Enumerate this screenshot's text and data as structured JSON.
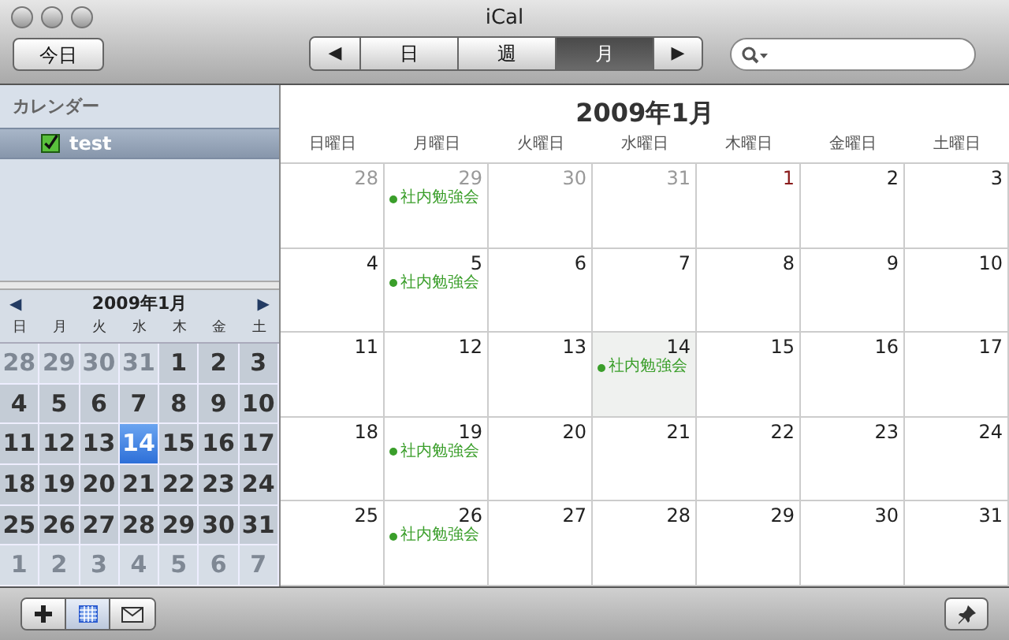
{
  "window": {
    "title": "iCal"
  },
  "toolbar": {
    "today_button": "今日",
    "prev": "◀",
    "next": "▶",
    "views": [
      {
        "label": "日",
        "selected": false
      },
      {
        "label": "週",
        "selected": false
      },
      {
        "label": "月",
        "selected": true
      }
    ]
  },
  "sidebar": {
    "header": "カレンダー",
    "calendars": [
      {
        "name": "test",
        "checked": true,
        "selected": true
      }
    ]
  },
  "mini_calendar": {
    "title": "2009年1月",
    "prev": "◀",
    "next": "▶",
    "weekdays": [
      "日",
      "月",
      "火",
      "水",
      "木",
      "金",
      "土"
    ],
    "days": [
      {
        "label": "28",
        "in_month": false,
        "selected": false
      },
      {
        "label": "29",
        "in_month": false,
        "selected": false
      },
      {
        "label": "30",
        "in_month": false,
        "selected": false
      },
      {
        "label": "31",
        "in_month": false,
        "selected": false
      },
      {
        "label": "1",
        "in_month": true,
        "selected": false
      },
      {
        "label": "2",
        "in_month": true,
        "selected": false
      },
      {
        "label": "3",
        "in_month": true,
        "selected": false
      },
      {
        "label": "4",
        "in_month": true,
        "selected": false
      },
      {
        "label": "5",
        "in_month": true,
        "selected": false
      },
      {
        "label": "6",
        "in_month": true,
        "selected": false
      },
      {
        "label": "7",
        "in_month": true,
        "selected": false
      },
      {
        "label": "8",
        "in_month": true,
        "selected": false
      },
      {
        "label": "9",
        "in_month": true,
        "selected": false
      },
      {
        "label": "10",
        "in_month": true,
        "selected": false
      },
      {
        "label": "11",
        "in_month": true,
        "selected": false
      },
      {
        "label": "12",
        "in_month": true,
        "selected": false
      },
      {
        "label": "13",
        "in_month": true,
        "selected": false
      },
      {
        "label": "14",
        "in_month": true,
        "selected": true
      },
      {
        "label": "15",
        "in_month": true,
        "selected": false
      },
      {
        "label": "16",
        "in_month": true,
        "selected": false
      },
      {
        "label": "17",
        "in_month": true,
        "selected": false
      },
      {
        "label": "18",
        "in_month": true,
        "selected": false
      },
      {
        "label": "19",
        "in_month": true,
        "selected": false
      },
      {
        "label": "20",
        "in_month": true,
        "selected": false
      },
      {
        "label": "21",
        "in_month": true,
        "selected": false
      },
      {
        "label": "22",
        "in_month": true,
        "selected": false
      },
      {
        "label": "23",
        "in_month": true,
        "selected": false
      },
      {
        "label": "24",
        "in_month": true,
        "selected": false
      },
      {
        "label": "25",
        "in_month": true,
        "selected": false
      },
      {
        "label": "26",
        "in_month": true,
        "selected": false
      },
      {
        "label": "27",
        "in_month": true,
        "selected": false
      },
      {
        "label": "28",
        "in_month": true,
        "selected": false
      },
      {
        "label": "29",
        "in_month": true,
        "selected": false
      },
      {
        "label": "30",
        "in_month": true,
        "selected": false
      },
      {
        "label": "31",
        "in_month": true,
        "selected": false
      },
      {
        "label": "1",
        "in_month": false,
        "selected": false
      },
      {
        "label": "2",
        "in_month": false,
        "selected": false
      },
      {
        "label": "3",
        "in_month": false,
        "selected": false
      },
      {
        "label": "4",
        "in_month": false,
        "selected": false
      },
      {
        "label": "5",
        "in_month": false,
        "selected": false
      },
      {
        "label": "6",
        "in_month": false,
        "selected": false
      },
      {
        "label": "7",
        "in_month": false,
        "selected": false
      }
    ]
  },
  "month_view": {
    "title": "2009年1月",
    "weekdays": [
      "日曜日",
      "月曜日",
      "火曜日",
      "水曜日",
      "木曜日",
      "金曜日",
      "土曜日"
    ],
    "days": [
      {
        "label": "28",
        "in_month": false,
        "holiday": false,
        "selected": false
      },
      {
        "label": "29",
        "in_month": false,
        "holiday": false,
        "selected": false,
        "events": [
          {
            "title": "社内勉強会",
            "color": "#3a9e2a"
          }
        ]
      },
      {
        "label": "30",
        "in_month": false,
        "holiday": false,
        "selected": false
      },
      {
        "label": "31",
        "in_month": false,
        "holiday": false,
        "selected": false
      },
      {
        "label": "1",
        "in_month": true,
        "holiday": true,
        "selected": false
      },
      {
        "label": "2",
        "in_month": true,
        "holiday": false,
        "selected": false
      },
      {
        "label": "3",
        "in_month": true,
        "holiday": false,
        "selected": false
      },
      {
        "label": "4",
        "in_month": true,
        "holiday": false,
        "selected": false
      },
      {
        "label": "5",
        "in_month": true,
        "holiday": false,
        "selected": false,
        "events": [
          {
            "title": "社内勉強会",
            "color": "#3a9e2a"
          }
        ]
      },
      {
        "label": "6",
        "in_month": true,
        "holiday": false,
        "selected": false
      },
      {
        "label": "7",
        "in_month": true,
        "holiday": false,
        "selected": false
      },
      {
        "label": "8",
        "in_month": true,
        "holiday": false,
        "selected": false
      },
      {
        "label": "9",
        "in_month": true,
        "holiday": false,
        "selected": false
      },
      {
        "label": "10",
        "in_month": true,
        "holiday": false,
        "selected": false
      },
      {
        "label": "11",
        "in_month": true,
        "holiday": false,
        "selected": false
      },
      {
        "label": "12",
        "in_month": true,
        "holiday": false,
        "selected": false
      },
      {
        "label": "13",
        "in_month": true,
        "holiday": false,
        "selected": false
      },
      {
        "label": "14",
        "in_month": true,
        "holiday": false,
        "selected": true,
        "events": [
          {
            "title": "社内勉強会",
            "color": "#3a9e2a"
          }
        ]
      },
      {
        "label": "15",
        "in_month": true,
        "holiday": false,
        "selected": false
      },
      {
        "label": "16",
        "in_month": true,
        "holiday": false,
        "selected": false
      },
      {
        "label": "17",
        "in_month": true,
        "holiday": false,
        "selected": false
      },
      {
        "label": "18",
        "in_month": true,
        "holiday": false,
        "selected": false
      },
      {
        "label": "19",
        "in_month": true,
        "holiday": false,
        "selected": false,
        "events": [
          {
            "title": "社内勉強会",
            "color": "#3a9e2a"
          }
        ]
      },
      {
        "label": "20",
        "in_month": true,
        "holiday": false,
        "selected": false
      },
      {
        "label": "21",
        "in_month": true,
        "holiday": false,
        "selected": false
      },
      {
        "label": "22",
        "in_month": true,
        "holiday": false,
        "selected": false
      },
      {
        "label": "23",
        "in_month": true,
        "holiday": false,
        "selected": false
      },
      {
        "label": "24",
        "in_month": true,
        "holiday": false,
        "selected": false
      },
      {
        "label": "25",
        "in_month": true,
        "holiday": false,
        "selected": false
      },
      {
        "label": "26",
        "in_month": true,
        "holiday": false,
        "selected": false,
        "events": [
          {
            "title": "社内勉強会",
            "color": "#3a9e2a"
          }
        ]
      },
      {
        "label": "27",
        "in_month": true,
        "holiday": false,
        "selected": false
      },
      {
        "label": "28",
        "in_month": true,
        "holiday": false,
        "selected": false
      },
      {
        "label": "29",
        "in_month": true,
        "holiday": false,
        "selected": false
      },
      {
        "label": "30",
        "in_month": true,
        "holiday": false,
        "selected": false
      },
      {
        "label": "31",
        "in_month": true,
        "holiday": false,
        "selected": false
      }
    ]
  },
  "bottom_bar": {
    "mini_calendar_toggle": {
      "on": true
    }
  }
}
